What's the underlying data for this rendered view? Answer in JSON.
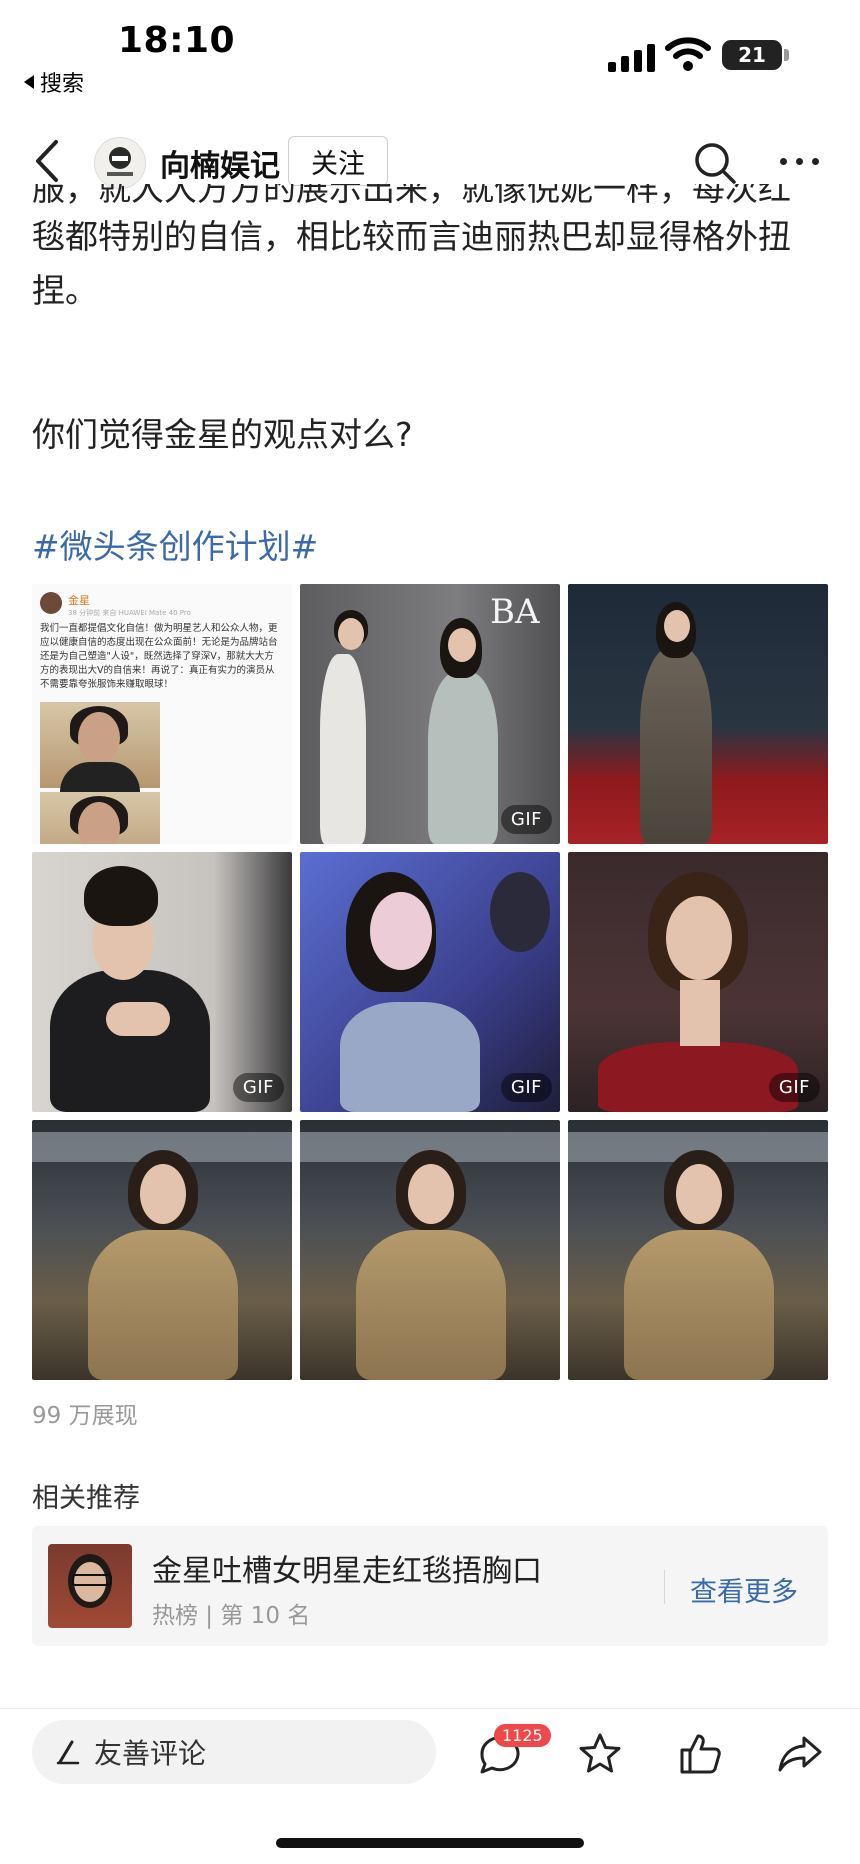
{
  "status_bar": {
    "time": "18:10",
    "back_app": "搜索",
    "battery": "21"
  },
  "nav": {
    "author": "向楠娱记",
    "follow_label": "关注"
  },
  "article": {
    "cut_line": "服，就大大方方的展示出来，就像倪妮一样，每次红",
    "para1": "毯都特别的自信，相比较而言迪丽热巴却显得格外扭捏。",
    "question": "你们觉得金星的观点对么?",
    "hashtag": "#微头条创作计划#"
  },
  "weibo_card": {
    "name": "金星",
    "meta": "38 分钟前  来自 HUAWEI Mate 40 Pro",
    "text": "我们一直都提倡文化自信！做为明星艺人和公众人物，更应以健康自信的态度出现在公众面前！无论是为品牌站台还是为自己塑造\"人设\"，既然选择了穿深V，那就大大方方的表现出大V的自信来！再说了：真正有实力的演员从不需要靠夸张服饰来赚取眼球！"
  },
  "images": [
    {
      "kind": "weibo-screenshot",
      "gif": false
    },
    {
      "kind": "red-carpet-two",
      "gif": true,
      "gif_label": "GIF"
    },
    {
      "kind": "red-carpet-walk",
      "gif": false
    },
    {
      "kind": "hand-on-chest",
      "gif": true,
      "gif_label": "GIF"
    },
    {
      "kind": "smile-blue-light",
      "gif": true,
      "gif_label": "GIF"
    },
    {
      "kind": "red-dress",
      "gif": true,
      "gif_label": "GIF"
    },
    {
      "kind": "gold-dress-1",
      "gif": false
    },
    {
      "kind": "gold-dress-2",
      "gif": false
    },
    {
      "kind": "gold-dress-3",
      "gif": false
    }
  ],
  "stats": {
    "views": "99 万展现"
  },
  "related": {
    "title": "相关推荐",
    "item_title": "金星吐槽女明星走红毯捂胸口",
    "item_sub": "热榜 | 第 10 名",
    "more": "查看更多"
  },
  "bottom_bar": {
    "comment_placeholder": "友善评论",
    "comment_count": "1125"
  },
  "colors": {
    "link": "#3a6aa8",
    "badge": "#f04848"
  }
}
